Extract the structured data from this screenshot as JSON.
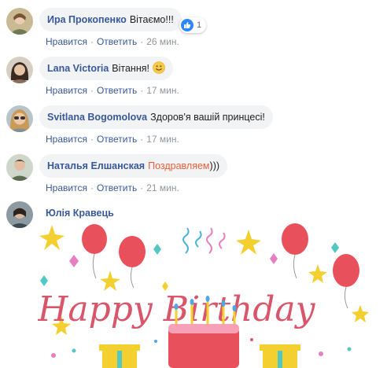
{
  "comments": [
    {
      "author": "Ира Прокопенко",
      "text": "Вітаємо!!!",
      "actions": {
        "like": "Нравится",
        "reply": "Ответить",
        "time": "26 мин."
      },
      "reactions": {
        "count": "1"
      }
    },
    {
      "author": "Lana Victoria",
      "text": "Вітання!",
      "actions": {
        "like": "Нравится",
        "reply": "Ответить",
        "time": "17 мин."
      }
    },
    {
      "author": "Svitlana Bogomolova",
      "text": "Здоров'я вашій принцесі!",
      "actions": {
        "like": "Нравится",
        "reply": "Ответить",
        "time": "17 мин."
      }
    },
    {
      "author": "Наталья Елшанская",
      "text_highlight": "Поздравляем",
      "text_rest": ")))",
      "actions": {
        "like": "Нравится",
        "reply": "Ответить",
        "time": "21 мин."
      }
    }
  ],
  "gif_comment": {
    "author": "Юлія Кравець",
    "card_text": "Happy Birthday"
  },
  "separator": "·",
  "colors": {
    "link": "#385898",
    "bubble": "#f2f3f5",
    "muted": "#90949c",
    "highlight": "#e9603a",
    "like_blue": "#2d88ff",
    "card_text": "#d9556a"
  }
}
